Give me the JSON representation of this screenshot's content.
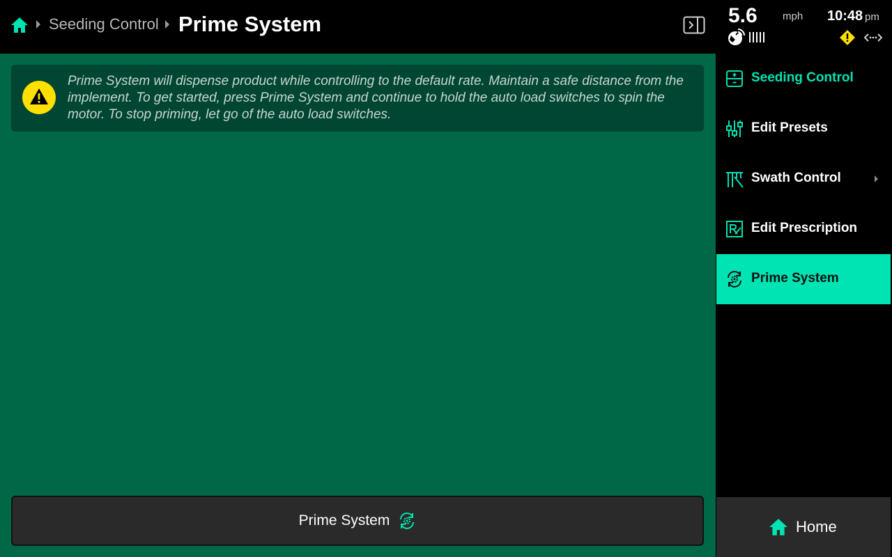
{
  "colors": {
    "accent": "#00e3b2",
    "main_bg": "#006747",
    "alert_bg": "#004632",
    "warning_yellow": "#ffe000",
    "button_bg": "#2a2a2a"
  },
  "header": {
    "home_icon": "home-icon",
    "breadcrumb_parent": "Seeding Control",
    "title": "Prime System",
    "panel_toggle_icon": "panel-toggle-icon"
  },
  "status": {
    "speed": "5.6",
    "speed_unit": "mph",
    "time": "10:48",
    "ampm": "pm",
    "gps_icon": "gps-satellite-icon",
    "signal_icon": "signal-bars-icon",
    "warning_icon": "warning-diamond-icon",
    "connection_icon": "connection-arrows-icon"
  },
  "alert": {
    "icon": "warning-icon",
    "message": "Prime System will dispense product while controlling to the default rate. Maintain a safe distance from the implement. To get started, press Prime System and continue to hold the auto load switches to spin the motor. To stop priming, let go of the auto load switches."
  },
  "main": {
    "prime_button_label": "Prime System",
    "prime_button_icon": "prime-gear-cycle-icon"
  },
  "sidebar": {
    "items": [
      {
        "label": "Seeding Control",
        "icon": "seeding-control-icon",
        "state": "current"
      },
      {
        "label": "Edit Presets",
        "icon": "sliders-icon",
        "state": "normal"
      },
      {
        "label": "Swath Control",
        "icon": "swath-control-icon",
        "state": "normal",
        "has_submenu": true
      },
      {
        "label": "Edit Prescription",
        "icon": "prescription-icon",
        "state": "normal"
      },
      {
        "label": "Prime System",
        "icon": "prime-gear-cycle-icon",
        "state": "active"
      }
    ],
    "home_label": "Home",
    "home_icon": "home-icon"
  }
}
